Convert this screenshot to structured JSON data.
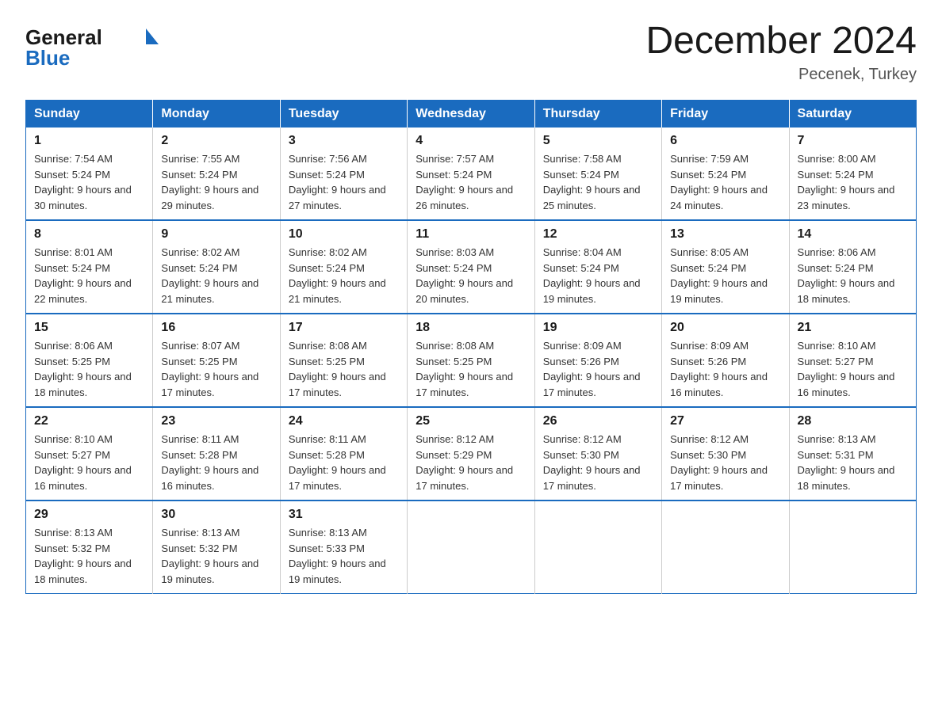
{
  "header": {
    "logo": {
      "general": "General",
      "triangle": "▶",
      "blue": "Blue"
    },
    "title": "December 2024",
    "location": "Pecenek, Turkey"
  },
  "days_of_week": [
    "Sunday",
    "Monday",
    "Tuesday",
    "Wednesday",
    "Thursday",
    "Friday",
    "Saturday"
  ],
  "weeks": [
    [
      {
        "day": "1",
        "sunrise": "7:54 AM",
        "sunset": "5:24 PM",
        "daylight": "9 hours and 30 minutes."
      },
      {
        "day": "2",
        "sunrise": "7:55 AM",
        "sunset": "5:24 PM",
        "daylight": "9 hours and 29 minutes."
      },
      {
        "day": "3",
        "sunrise": "7:56 AM",
        "sunset": "5:24 PM",
        "daylight": "9 hours and 27 minutes."
      },
      {
        "day": "4",
        "sunrise": "7:57 AM",
        "sunset": "5:24 PM",
        "daylight": "9 hours and 26 minutes."
      },
      {
        "day": "5",
        "sunrise": "7:58 AM",
        "sunset": "5:24 PM",
        "daylight": "9 hours and 25 minutes."
      },
      {
        "day": "6",
        "sunrise": "7:59 AM",
        "sunset": "5:24 PM",
        "daylight": "9 hours and 24 minutes."
      },
      {
        "day": "7",
        "sunrise": "8:00 AM",
        "sunset": "5:24 PM",
        "daylight": "9 hours and 23 minutes."
      }
    ],
    [
      {
        "day": "8",
        "sunrise": "8:01 AM",
        "sunset": "5:24 PM",
        "daylight": "9 hours and 22 minutes."
      },
      {
        "day": "9",
        "sunrise": "8:02 AM",
        "sunset": "5:24 PM",
        "daylight": "9 hours and 21 minutes."
      },
      {
        "day": "10",
        "sunrise": "8:02 AM",
        "sunset": "5:24 PM",
        "daylight": "9 hours and 21 minutes."
      },
      {
        "day": "11",
        "sunrise": "8:03 AM",
        "sunset": "5:24 PM",
        "daylight": "9 hours and 20 minutes."
      },
      {
        "day": "12",
        "sunrise": "8:04 AM",
        "sunset": "5:24 PM",
        "daylight": "9 hours and 19 minutes."
      },
      {
        "day": "13",
        "sunrise": "8:05 AM",
        "sunset": "5:24 PM",
        "daylight": "9 hours and 19 minutes."
      },
      {
        "day": "14",
        "sunrise": "8:06 AM",
        "sunset": "5:24 PM",
        "daylight": "9 hours and 18 minutes."
      }
    ],
    [
      {
        "day": "15",
        "sunrise": "8:06 AM",
        "sunset": "5:25 PM",
        "daylight": "9 hours and 18 minutes."
      },
      {
        "day": "16",
        "sunrise": "8:07 AM",
        "sunset": "5:25 PM",
        "daylight": "9 hours and 17 minutes."
      },
      {
        "day": "17",
        "sunrise": "8:08 AM",
        "sunset": "5:25 PM",
        "daylight": "9 hours and 17 minutes."
      },
      {
        "day": "18",
        "sunrise": "8:08 AM",
        "sunset": "5:25 PM",
        "daylight": "9 hours and 17 minutes."
      },
      {
        "day": "19",
        "sunrise": "8:09 AM",
        "sunset": "5:26 PM",
        "daylight": "9 hours and 17 minutes."
      },
      {
        "day": "20",
        "sunrise": "8:09 AM",
        "sunset": "5:26 PM",
        "daylight": "9 hours and 16 minutes."
      },
      {
        "day": "21",
        "sunrise": "8:10 AM",
        "sunset": "5:27 PM",
        "daylight": "9 hours and 16 minutes."
      }
    ],
    [
      {
        "day": "22",
        "sunrise": "8:10 AM",
        "sunset": "5:27 PM",
        "daylight": "9 hours and 16 minutes."
      },
      {
        "day": "23",
        "sunrise": "8:11 AM",
        "sunset": "5:28 PM",
        "daylight": "9 hours and 16 minutes."
      },
      {
        "day": "24",
        "sunrise": "8:11 AM",
        "sunset": "5:28 PM",
        "daylight": "9 hours and 17 minutes."
      },
      {
        "day": "25",
        "sunrise": "8:12 AM",
        "sunset": "5:29 PM",
        "daylight": "9 hours and 17 minutes."
      },
      {
        "day": "26",
        "sunrise": "8:12 AM",
        "sunset": "5:30 PM",
        "daylight": "9 hours and 17 minutes."
      },
      {
        "day": "27",
        "sunrise": "8:12 AM",
        "sunset": "5:30 PM",
        "daylight": "9 hours and 17 minutes."
      },
      {
        "day": "28",
        "sunrise": "8:13 AM",
        "sunset": "5:31 PM",
        "daylight": "9 hours and 18 minutes."
      }
    ],
    [
      {
        "day": "29",
        "sunrise": "8:13 AM",
        "sunset": "5:32 PM",
        "daylight": "9 hours and 18 minutes."
      },
      {
        "day": "30",
        "sunrise": "8:13 AM",
        "sunset": "5:32 PM",
        "daylight": "9 hours and 19 minutes."
      },
      {
        "day": "31",
        "sunrise": "8:13 AM",
        "sunset": "5:33 PM",
        "daylight": "9 hours and 19 minutes."
      },
      null,
      null,
      null,
      null
    ]
  ],
  "labels": {
    "sunrise_prefix": "Sunrise: ",
    "sunset_prefix": "Sunset: ",
    "daylight_prefix": "Daylight: "
  }
}
